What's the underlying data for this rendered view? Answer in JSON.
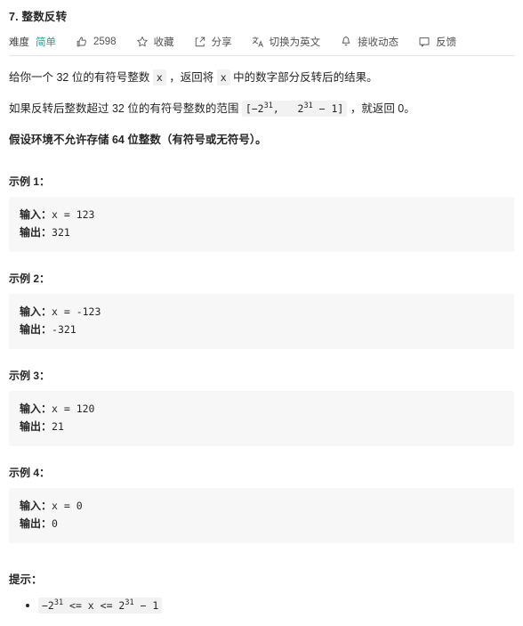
{
  "problem": {
    "title": "7. 整数反转"
  },
  "meta": {
    "difficulty_label": "难度",
    "difficulty_value": "简单",
    "difficulty_color": "#00af9b",
    "like_count": "2598",
    "favorite_label": "收藏",
    "share_label": "分享",
    "switch_lang_label": "切换为英文",
    "subscribe_label": "接收动态",
    "feedback_label": "反馈",
    "icons": {
      "thumbs_up": "thumbs-up-icon",
      "star": "star-icon",
      "share": "share-icon",
      "translate": "translate-icon",
      "bell": "bell-icon",
      "feedback": "feedback-icon"
    }
  },
  "description": {
    "p1_a": "给你一个 32 位的有符号整数 ",
    "p1_code": "x",
    "p1_b": " ，返回将 ",
    "p1_code2": "x",
    "p1_c": " 中的数字部分反转后的结果。",
    "p2_a": "如果反转后整数超过 32 位的有符号整数的范围 ",
    "p2_code_pre": "[−2",
    "p2_code_sup1": "31",
    "p2_code_mid": ",   2",
    "p2_code_sup2": "31",
    "p2_code_post": " − 1]",
    "p2_b": " ，就返回 0。",
    "p3": "假设环境不允许存储 64 位整数（有符号或无符号）。"
  },
  "examples": [
    {
      "heading": "示例 1：",
      "input_label": "输入：",
      "input_value": "x = 123",
      "output_label": "输出：",
      "output_value": "321"
    },
    {
      "heading": "示例 2：",
      "input_label": "输入：",
      "input_value": "x = -123",
      "output_label": "输出：",
      "output_value": "-321"
    },
    {
      "heading": "示例 3：",
      "input_label": "输入：",
      "input_value": "x = 120",
      "output_label": "输出：",
      "output_value": "21"
    },
    {
      "heading": "示例 4：",
      "input_label": "输入：",
      "input_value": "x = 0",
      "output_label": "输出：",
      "output_value": "0"
    }
  ],
  "hints": {
    "title": "提示：",
    "items": [
      {
        "pre": "−2",
        "sup1": "31",
        "mid": " <= x <= 2",
        "sup2": "31",
        "post": " − 1"
      }
    ]
  }
}
